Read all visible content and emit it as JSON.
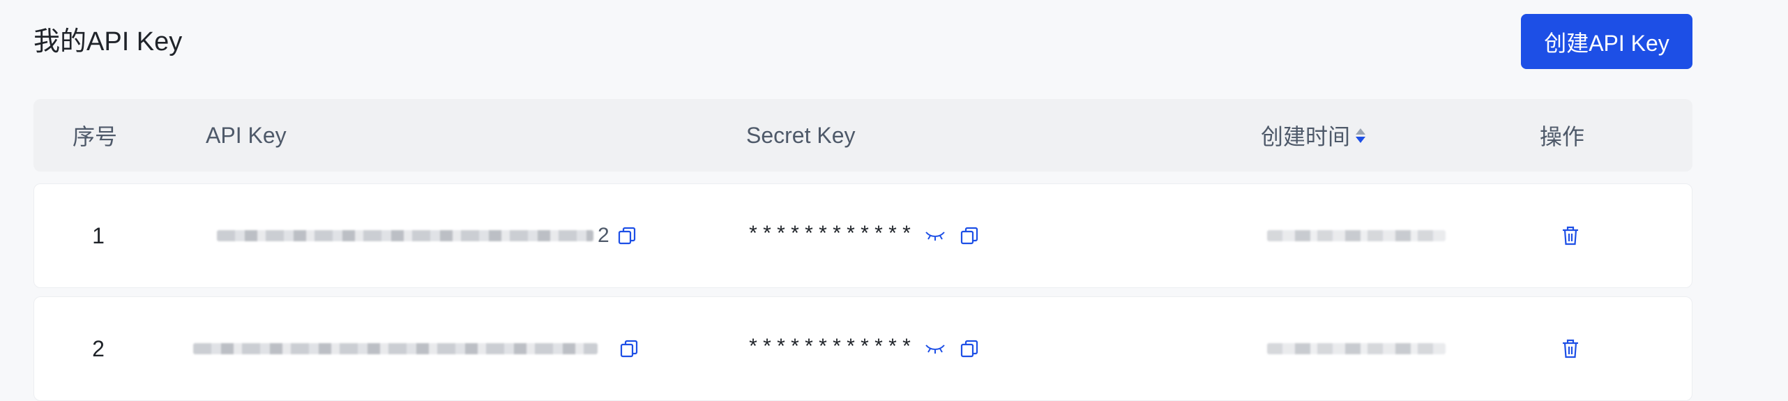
{
  "page": {
    "title": "我的API Key"
  },
  "toolbar": {
    "create_label": "创建API Key"
  },
  "table": {
    "columns": {
      "index": "序号",
      "api_key": "API Key",
      "secret_key": "Secret Key",
      "created_at": "创建时间",
      "actions": "操作"
    },
    "sort_icon": "sort-icon",
    "rows": [
      {
        "index": "1",
        "api_key_tail": "2",
        "secret_masked": "************"
      },
      {
        "index": "2",
        "api_key_tail": "",
        "secret_masked": "************"
      }
    ]
  },
  "icons": {
    "copy": "copy-icon",
    "eye_closed": "eye-closed-icon",
    "delete": "trash-icon"
  },
  "colors": {
    "accent": "#1d4fe6",
    "header_bg": "#f0f1f3",
    "page_bg": "#f7f8fa"
  }
}
